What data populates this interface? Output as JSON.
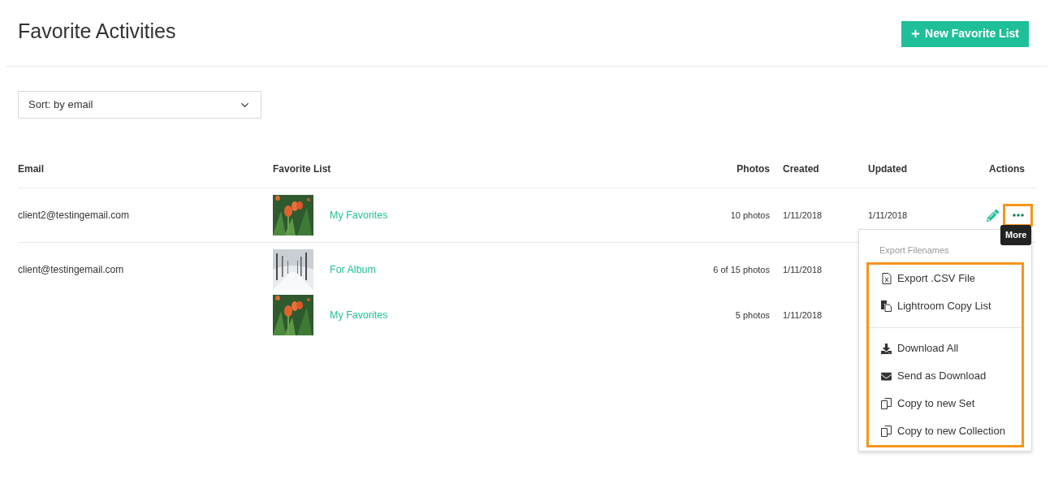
{
  "page": {
    "title": "Favorite Activities",
    "new_button": "New Favorite List"
  },
  "sort": {
    "value": "Sort: by email"
  },
  "table": {
    "columns": [
      "Email",
      "Favorite List",
      "Photos",
      "Created",
      "Updated",
      "Actions"
    ],
    "groups": [
      {
        "email": "client2@testingemail.com",
        "lists": [
          {
            "name": "My Favorites",
            "photos": "10 photos",
            "created": "1/11/2018",
            "updated": "1/11/2018"
          }
        ]
      },
      {
        "email": "client@testingemail.com",
        "lists": [
          {
            "name": "For Album",
            "photos": "6 of 15 photos",
            "created": "1/11/2018"
          },
          {
            "name": "My Favorites",
            "photos": "5 photos",
            "created": "1/11/2018"
          }
        ]
      }
    ]
  },
  "tooltip": "More",
  "menu": {
    "header": "Export Filenames",
    "sections": [
      [
        "Export .CSV File",
        "Lightroom Copy List"
      ],
      [
        "Download All",
        "Send as Download",
        "Copy to new Set",
        "Copy to new Collection"
      ]
    ]
  }
}
